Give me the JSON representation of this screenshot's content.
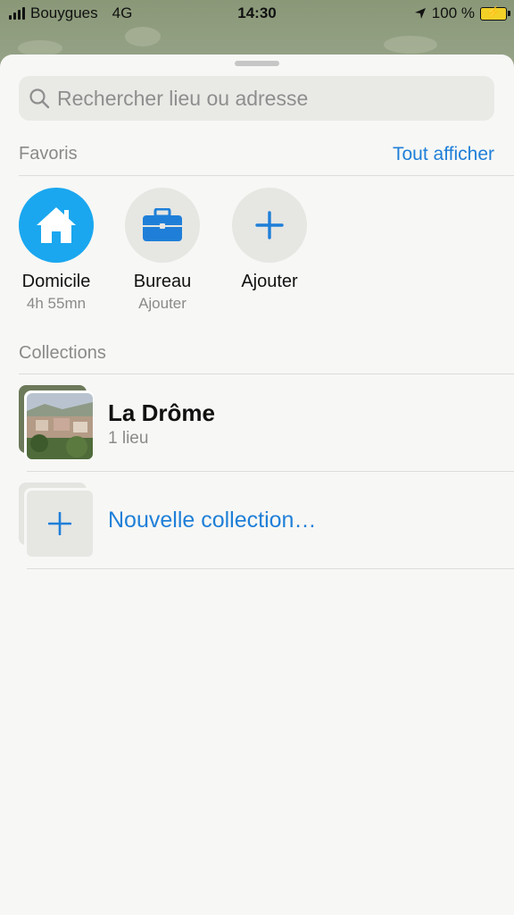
{
  "status": {
    "carrier": "Bouygues",
    "network": "4G",
    "time": "14:30",
    "battery": "100 %"
  },
  "search": {
    "placeholder": "Rechercher lieu ou adresse"
  },
  "favorites": {
    "title": "Favoris",
    "show_all": "Tout afficher",
    "items": [
      {
        "name": "Domicile",
        "sub": "4h 55mn",
        "icon": "home-icon",
        "color": "#1aa7ef"
      },
      {
        "name": "Bureau",
        "sub": "Ajouter",
        "icon": "briefcase-icon",
        "color": "#1f7fd8"
      },
      {
        "name": "Ajouter",
        "sub": "",
        "icon": "plus-icon",
        "color": "#1f7fd8"
      }
    ]
  },
  "collections": {
    "title": "Collections",
    "items": [
      {
        "title": "La Drôme",
        "count": "1 lieu"
      }
    ],
    "new_label": "Nouvelle collection…"
  }
}
